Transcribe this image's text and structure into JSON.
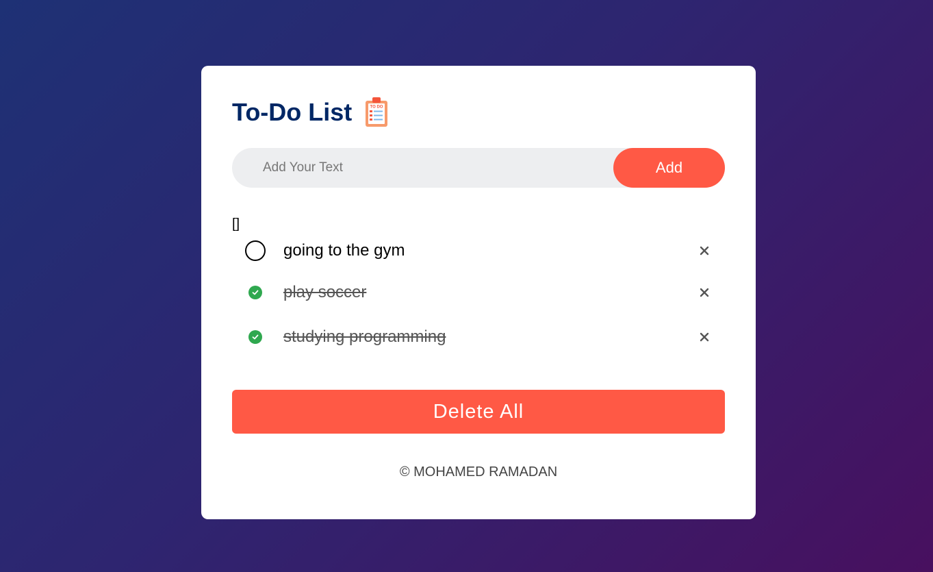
{
  "app": {
    "title": "To-Do List",
    "title_icon": "clipboard-todo-icon"
  },
  "input": {
    "placeholder": "Add Your Text",
    "value": ""
  },
  "add_button": {
    "label": "Add"
  },
  "debug_text": "[]",
  "tasks": [
    {
      "text": "going to the gym",
      "done": false
    },
    {
      "text": "play soccer",
      "done": true
    },
    {
      "text": "studying programming",
      "done": true
    }
  ],
  "delete_all_button": {
    "label": "Delete All"
  },
  "footer": {
    "text": "© MOHAMED RAMADAN"
  },
  "colors": {
    "accent": "#ff5945",
    "title": "#002765",
    "check": "#2fa84f",
    "background_start": "#1e3175",
    "background_end": "#48105f"
  }
}
